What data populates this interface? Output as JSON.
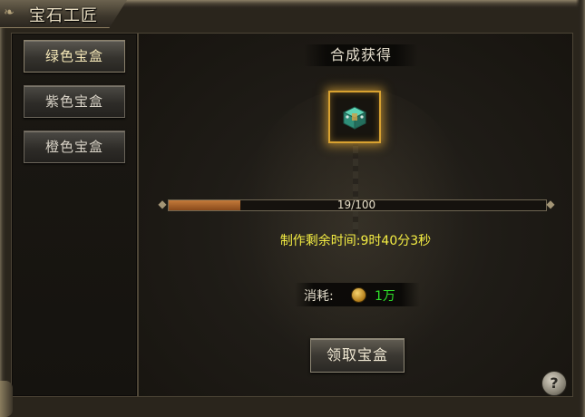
{
  "window": {
    "title": "宝石工匠"
  },
  "sidebar": {
    "tabs": [
      {
        "label": "绿色宝盒",
        "active": true
      },
      {
        "label": "紫色宝盒",
        "active": false
      },
      {
        "label": "橙色宝盒",
        "active": false
      }
    ]
  },
  "main": {
    "header": "合成获得",
    "item": {
      "icon": "green-treasure-box-icon"
    },
    "progress": {
      "text": "19/100",
      "current": 19,
      "total": 100
    },
    "timer": "制作剩余时间:9时40分3秒",
    "cost": {
      "label": "消耗:",
      "icon": "gold-coin-icon",
      "value": "1万"
    },
    "claim_button": "领取宝盒"
  },
  "help": {
    "label": "?"
  },
  "colors": {
    "highlight_gold": "#d9a230",
    "timer_yellow": "#f5ee43",
    "cost_green": "#2fe02b",
    "progress_fill": "#c47b3a"
  }
}
